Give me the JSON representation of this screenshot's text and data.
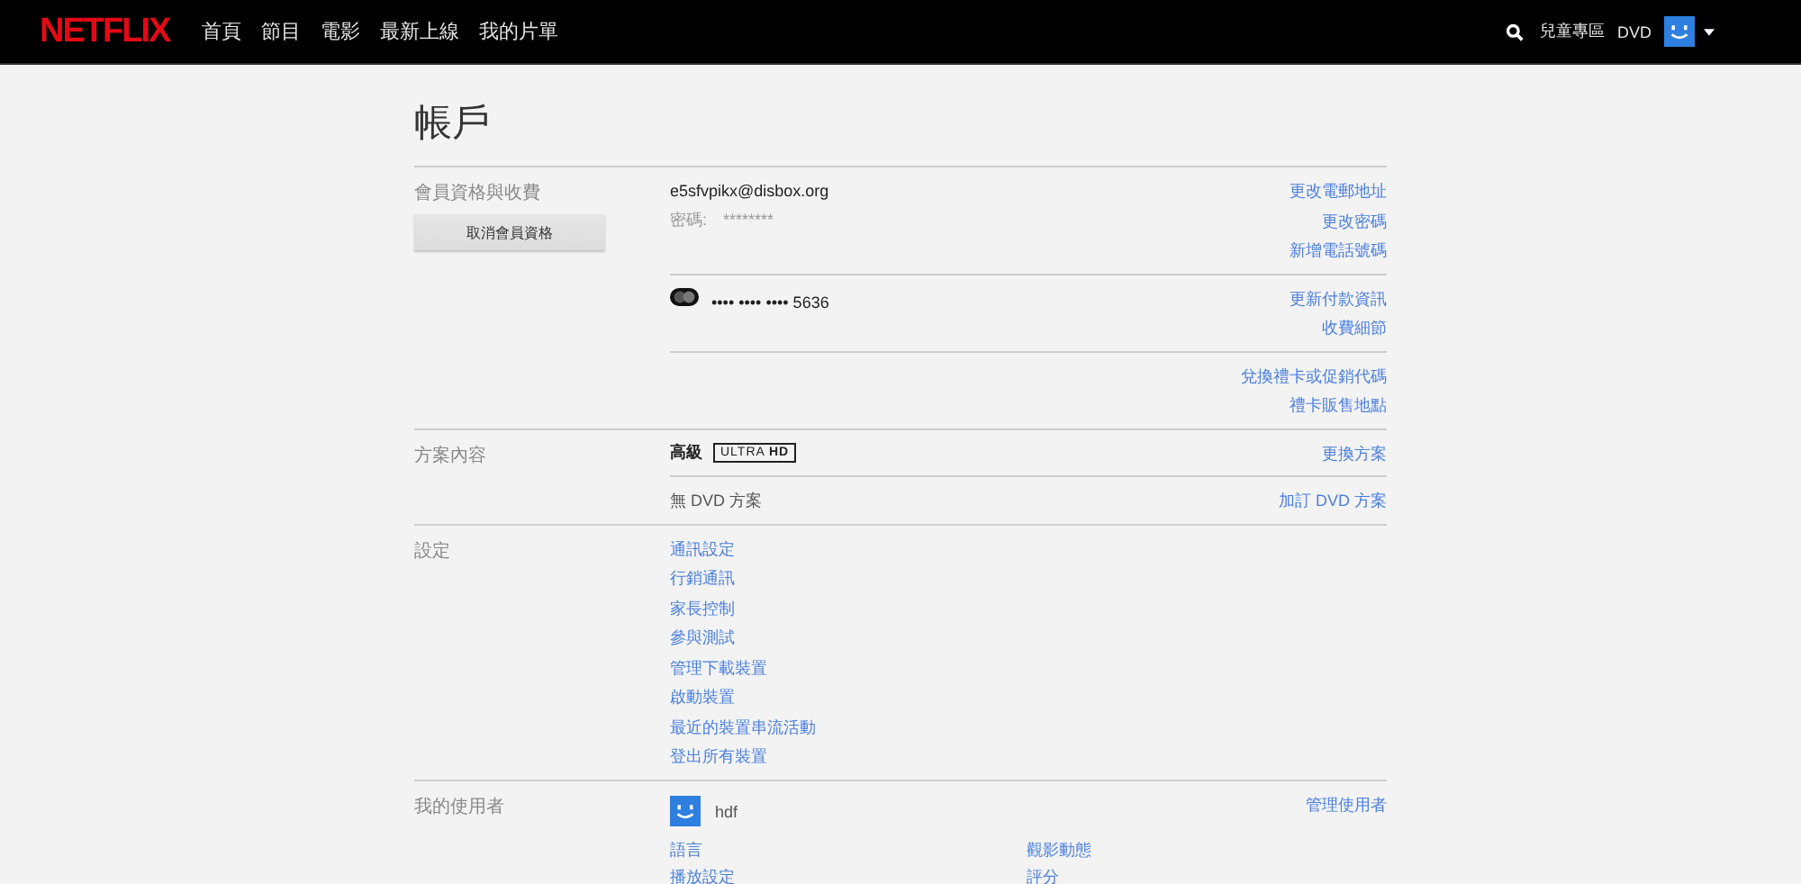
{
  "header": {
    "logo": "NETFLIX",
    "nav": [
      {
        "label": "首頁",
        "selected": false
      },
      {
        "label": "節目",
        "selected": false
      },
      {
        "label": "電影",
        "selected": false
      },
      {
        "label": "最新上線",
        "selected": false
      },
      {
        "label": "我的片單",
        "selected": false
      }
    ],
    "kids": "兒童專區",
    "dvd": "DVD"
  },
  "title": "帳戶",
  "sections": [
    {
      "label": "會員資格與收費",
      "button": "取消會員資格",
      "blocks": [
        {
          "items": [
            {
              "kind": "email",
              "text": "e5sfvpikx@disbox.org"
            },
            {
              "kind": "field",
              "label": "密碼:",
              "value": "********"
            }
          ],
          "links": [
            "更改電郵地址",
            "更改密碼",
            "新增電話號碼"
          ]
        },
        {
          "items": [
            {
              "kind": "card",
              "text": "•••• •••• •••• 5636"
            }
          ],
          "links": [
            "更新付款資訊",
            "收費細節"
          ]
        },
        {
          "links": [
            "兌換禮卡或促銷代碼",
            "禮卡販售地點"
          ]
        }
      ]
    },
    {
      "label": "方案內容",
      "blocks": [
        {
          "items": [
            {
              "kind": "plan",
              "text": "高級",
              "badge": "ULTRA **HD**"
            }
          ],
          "links": [
            "更換方案"
          ]
        },
        {
          "items": [
            {
              "kind": "text",
              "text": "無 DVD 方案"
            }
          ],
          "links": [
            "加訂 DVD 方案"
          ]
        }
      ]
    },
    {
      "label": "設定",
      "blocks": [
        {
          "items": [
            {
              "kind": "linklist",
              "links": [
                "通訊設定",
                "行銷通訊",
                "家長控制",
                "參與測試",
                "管理下載裝置",
                "啟動裝置",
                "最近的裝置串流活動",
                "登出所有裝置"
              ]
            }
          ]
        }
      ]
    },
    {
      "label": "我的使用者",
      "blocks": [
        {
          "items": [
            {
              "kind": "profile",
              "name": "hdf"
            }
          ],
          "links": [
            "管理使用者"
          ]
        }
      ],
      "grid": [
        "語言",
        "觀影動態",
        "播放設定",
        "評分"
      ]
    }
  ]
}
